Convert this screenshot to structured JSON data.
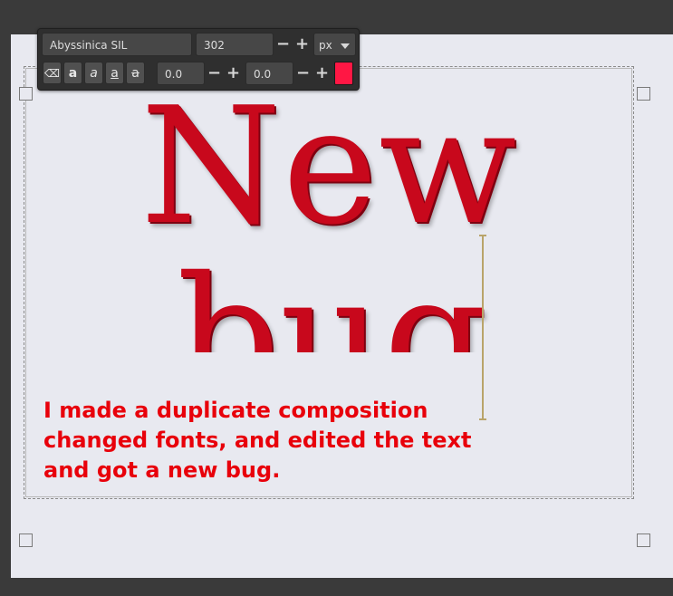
{
  "toolbar": {
    "font_name": "Abyssinica SIL",
    "font_size": "302",
    "unit": "px",
    "letter_spacing": "0.0",
    "line_spacing": "0.0",
    "color": "#ff1744",
    "style_buttons": [
      {
        "icon": "clear-style-icon",
        "glyph": "⌫"
      },
      {
        "icon": "bold-icon",
        "glyph": "a"
      },
      {
        "icon": "italic-icon",
        "glyph": "a"
      },
      {
        "icon": "underline-icon",
        "glyph": "a"
      },
      {
        "icon": "strikethrough-icon",
        "glyph": "a"
      }
    ],
    "minus": "−",
    "plus": "+"
  },
  "canvas": {
    "line1": "New",
    "line2": "bug",
    "text_color": "#c8081c"
  },
  "caption": {
    "lines": [
      "I made a duplicate composition",
      "changed fonts, and edited the text",
      "and got a new bug."
    ],
    "color": "#e8000b"
  }
}
